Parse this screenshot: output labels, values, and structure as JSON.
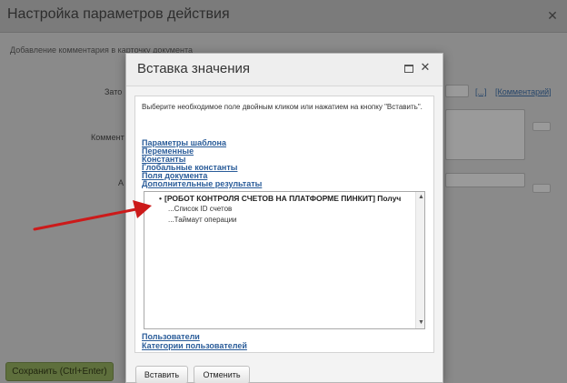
{
  "background_dialog": {
    "title": "Настройка параметров действия",
    "subtitle": "Добавление комментария в карточку документа",
    "labels": [
      "Зато",
      "Коммент",
      "А"
    ],
    "links": [
      "[...]",
      "[Комментарий]"
    ],
    "save_button": "Сохранить (Ctrl+Enter)"
  },
  "modal": {
    "title": "Вставка значения",
    "hint": "Выберите необходимое поле двойным кликом или нажатием на кнопку \"Вставить\".",
    "categories": [
      "Параметры шаблона",
      "Переменные",
      "Константы",
      "Глобальные константы",
      "Поля документа",
      "Дополнительные результаты"
    ],
    "list": {
      "root": "[РОБОТ КОНТРОЛЯ СЧЕТОВ НА ПЛАТФОРМЕ ПИНКИТ] Получ",
      "children": [
        "...Список ID счетов",
        "...Таймаут операции"
      ]
    },
    "bottom_categories": [
      "Пользователи",
      "Категории пользователей"
    ],
    "buttons": {
      "insert": "Вставить",
      "cancel": "Отменить"
    }
  },
  "colors": {
    "link": "#2a5c99",
    "arrow": "#cc1a1a",
    "overlay": "#8a8a8a"
  }
}
